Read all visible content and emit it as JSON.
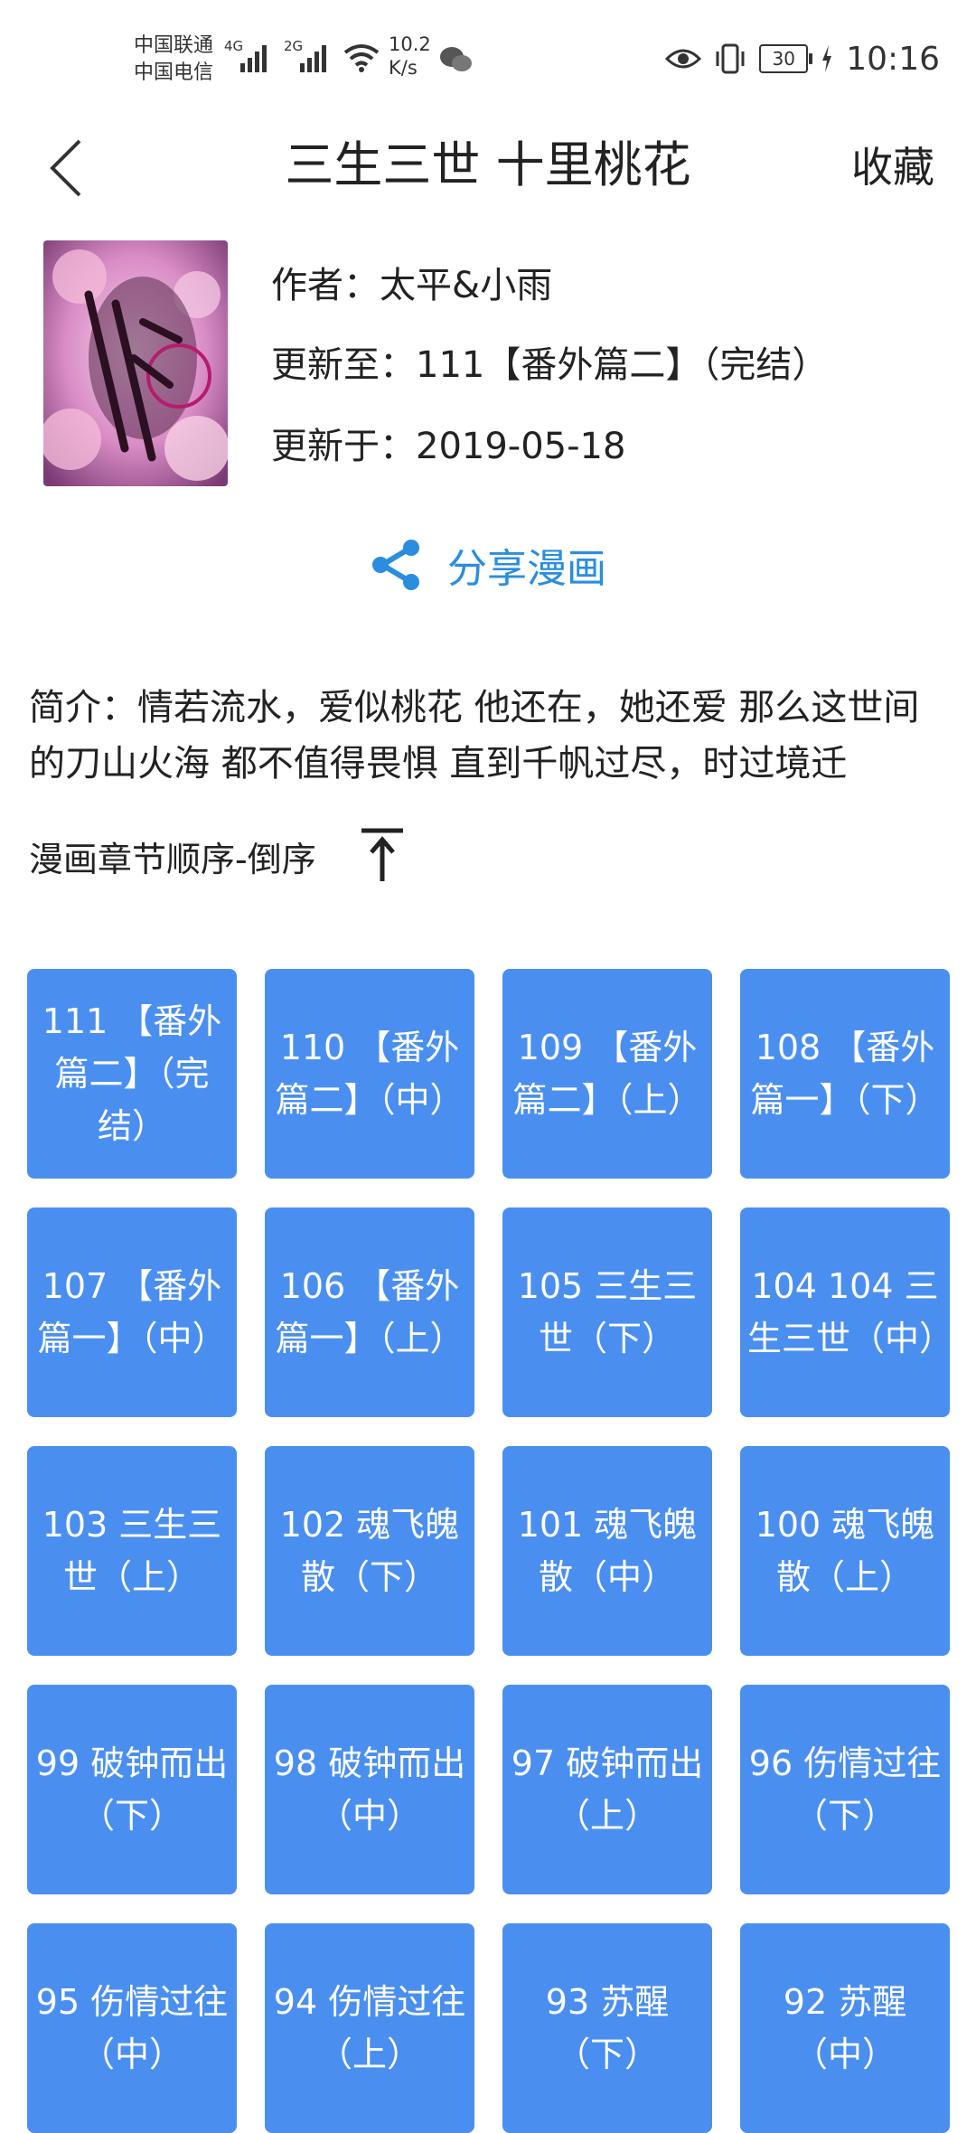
{
  "status_bar": {
    "carrier_1": "中国联通",
    "carrier_2": "中国电信",
    "net_1": "4G",
    "net_2": "2G",
    "speed_value": "10.2",
    "speed_unit": "K/s",
    "battery": "30",
    "time": "10:16"
  },
  "header": {
    "title": "三生三世 十里桃花",
    "favorite": "收藏"
  },
  "book": {
    "author": "作者：太平&小雨",
    "update_to": "更新至：111【番外篇二】（完结）",
    "updated_at": "更新于：2019-05-18"
  },
  "share": {
    "label": "分享漫画"
  },
  "intro": "简介：情若流水，爱似桃花 他还在，她还爱 那么这世间的刀山火海 都不值得畏惧 直到千帆过尽，时过境迁",
  "order": {
    "label": "漫画章节顺序-倒序"
  },
  "chapters": [
    "111 【番外篇二】（完结）",
    "110 【番外篇二】（中）",
    "109 【番外篇二】（上）",
    "108 【番外篇一】（下）",
    "107 【番外篇一】（中）",
    "106 【番外篇一】（上）",
    "105 三生三世（下）",
    "104 104 三生三世（中）",
    "103 三生三世（上）",
    "102 魂飞魄散（下）",
    "101 魂飞魄散（中）",
    "100 魂飞魄散（上）",
    "99 破钟而出（下）",
    "98 破钟而出（中）",
    "97 破钟而出（上）",
    "96 伤情过往（下）",
    "95 伤情过往（中）",
    "94 伤情过往（上）",
    "93 苏醒（下）",
    "92 苏醒（中）"
  ],
  "colors": {
    "accent": "#2a8de0",
    "chapter_bg": "#4a8ff0"
  }
}
